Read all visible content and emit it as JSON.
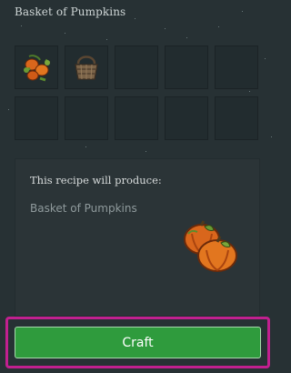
{
  "window": {
    "title": "Basket of Pumpkins"
  },
  "ingredients": {
    "slots": [
      {
        "icon": "pumpkin-vine-icon"
      },
      {
        "icon": "basket-icon"
      },
      {
        "icon": ""
      },
      {
        "icon": ""
      },
      {
        "icon": ""
      },
      {
        "icon": ""
      },
      {
        "icon": ""
      },
      {
        "icon": ""
      },
      {
        "icon": ""
      },
      {
        "icon": ""
      }
    ]
  },
  "recipe": {
    "heading": "This recipe will produce:",
    "product_name": "Basket of Pumpkins",
    "product_icon": "basket-of-pumpkins-icon"
  },
  "actions": {
    "craft_label": "Craft"
  },
  "colors": {
    "background": "#273134",
    "slot": "#222c2f",
    "craft_button": "#2f9b3d",
    "highlight_border": "#c1208f"
  }
}
